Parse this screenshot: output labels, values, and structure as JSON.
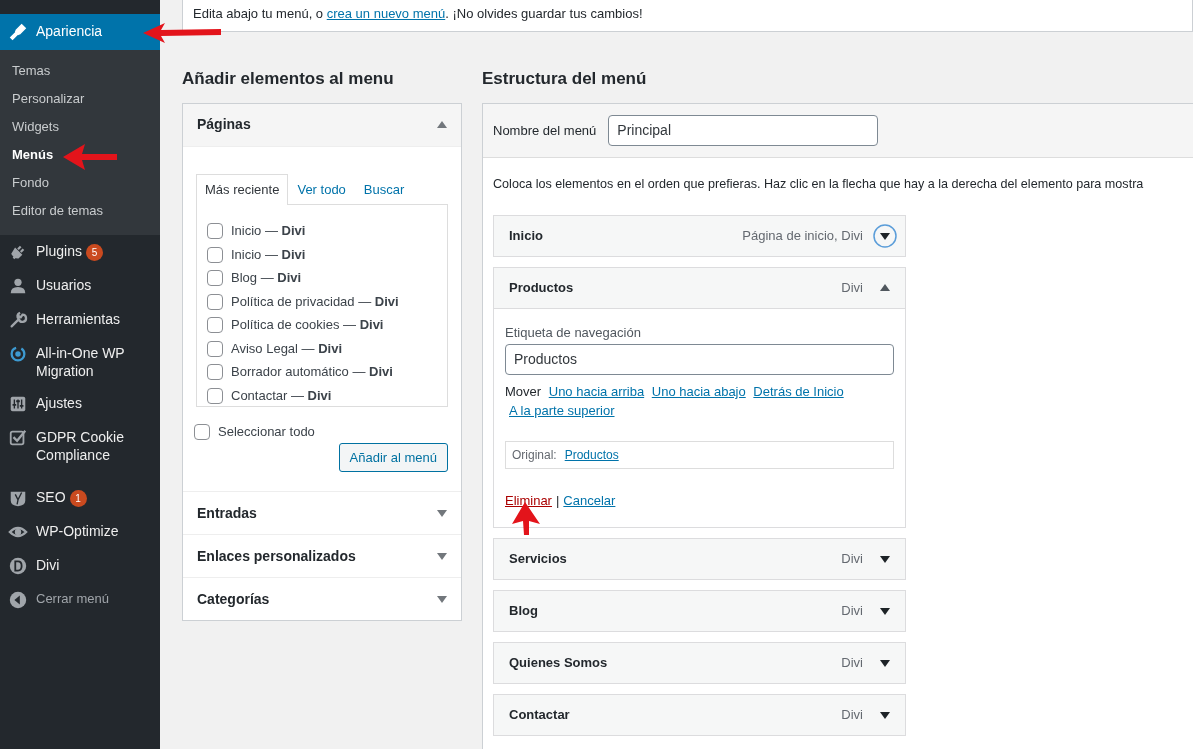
{
  "sidebar": {
    "items": [
      {
        "label": "Apariencia",
        "kind": "appearance",
        "selected": true,
        "submenu": [
          {
            "label": "Temas",
            "selected": false
          },
          {
            "label": "Personalizar",
            "selected": false
          },
          {
            "label": "Widgets",
            "selected": false
          },
          {
            "label": "Menús",
            "selected": true
          },
          {
            "label": "Fondo",
            "selected": false
          },
          {
            "label": "Editor de temas",
            "selected": false
          }
        ]
      },
      {
        "label": "Plugins",
        "kind": "plugins",
        "selected": false,
        "badge": "5"
      },
      {
        "label": "Usuarios",
        "kind": "users",
        "selected": false
      },
      {
        "label": "Herramientas",
        "kind": "tools",
        "selected": false
      },
      {
        "label": "All-in-One WP Migration",
        "kind": "migration",
        "selected": false
      },
      {
        "label": "Ajustes",
        "kind": "settings",
        "selected": false
      },
      {
        "label": "GDPR Cookie Compliance",
        "kind": "gdpr",
        "selected": false
      },
      {
        "label": "SEO",
        "kind": "seo",
        "selected": false,
        "badge": "1"
      },
      {
        "label": "WP-Optimize",
        "kind": "optimize",
        "selected": false
      },
      {
        "label": "Divi",
        "kind": "divi",
        "selected": false
      },
      {
        "label": "Cerrar menú",
        "kind": "collapse",
        "selected": false
      }
    ]
  },
  "notice": {
    "before": "Edita abajo tu menú, o ",
    "link": "crea un nuevo menú",
    "after": ". ¡No olvides guardar tus cambios!"
  },
  "add_items": {
    "title": "Añadir elementos al menu",
    "sections": [
      {
        "title": "Páginas",
        "expanded": true,
        "tabs": [
          {
            "label": "Más reciente",
            "selected": true
          },
          {
            "label": "Ver todo",
            "selected": false
          },
          {
            "label": "Buscar",
            "selected": false
          }
        ],
        "items": [
          {
            "label": "Inicio — **Divi**",
            "checked": false
          },
          {
            "label": "Inicio — **Divi**",
            "checked": false
          },
          {
            "label": "Blog — **Divi**",
            "checked": false
          },
          {
            "label": "Política de privacidad — **Divi**",
            "checked": false
          },
          {
            "label": "Política de cookies — **Divi**",
            "checked": false
          },
          {
            "label": "Aviso Legal — **Divi**",
            "checked": false
          },
          {
            "label": "Borrador automático — **Divi**",
            "checked": false
          },
          {
            "label": "Contactar — **Divi**",
            "checked": false
          }
        ],
        "select_all": {
          "label": "Seleccionar todo",
          "checked": false
        },
        "button": "Añadir al menú"
      },
      {
        "title": "Entradas",
        "expanded": false
      },
      {
        "title": "Enlaces personalizados",
        "expanded": false
      },
      {
        "title": "Categorías",
        "expanded": false
      }
    ]
  },
  "structure": {
    "title": "Estructura del menú",
    "menu_name": {
      "label": "Nombre del menú",
      "value": "Principal"
    },
    "instructions": "Coloca los elementos en el orden que prefieras. Haz clic en la flecha que hay a la derecha del elemento para mostra",
    "items": [
      {
        "title": "Inicio",
        "type": "Página de inicio, Divi",
        "expanded": false,
        "focused": true
      },
      {
        "title": "Productos",
        "type": "Divi",
        "expanded": true,
        "focused": false,
        "nav_label": {
          "label": "Etiqueta de navegación",
          "value": "Productos"
        },
        "move": {
          "label": "Mover",
          "links": [
            "Uno hacia arriba",
            "Uno hacia abajo",
            "Detrás de Inicio",
            "A la parte superior"
          ]
        },
        "original": {
          "label": "Original:",
          "link": "Productos"
        },
        "actions": [
          {
            "label": "Eliminar",
            "kind": "delete"
          },
          {
            "label": "Cancelar",
            "kind": "cancel"
          }
        ],
        "separator": "|"
      },
      {
        "title": "Servicios",
        "type": "Divi",
        "expanded": false,
        "focused": false
      },
      {
        "title": "Blog",
        "type": "Divi",
        "expanded": false,
        "focused": false
      },
      {
        "title": "Quienes Somos",
        "type": "Divi",
        "expanded": false,
        "focused": false
      },
      {
        "title": "Contactar",
        "type": "Divi",
        "expanded": false,
        "focused": false
      }
    ]
  }
}
